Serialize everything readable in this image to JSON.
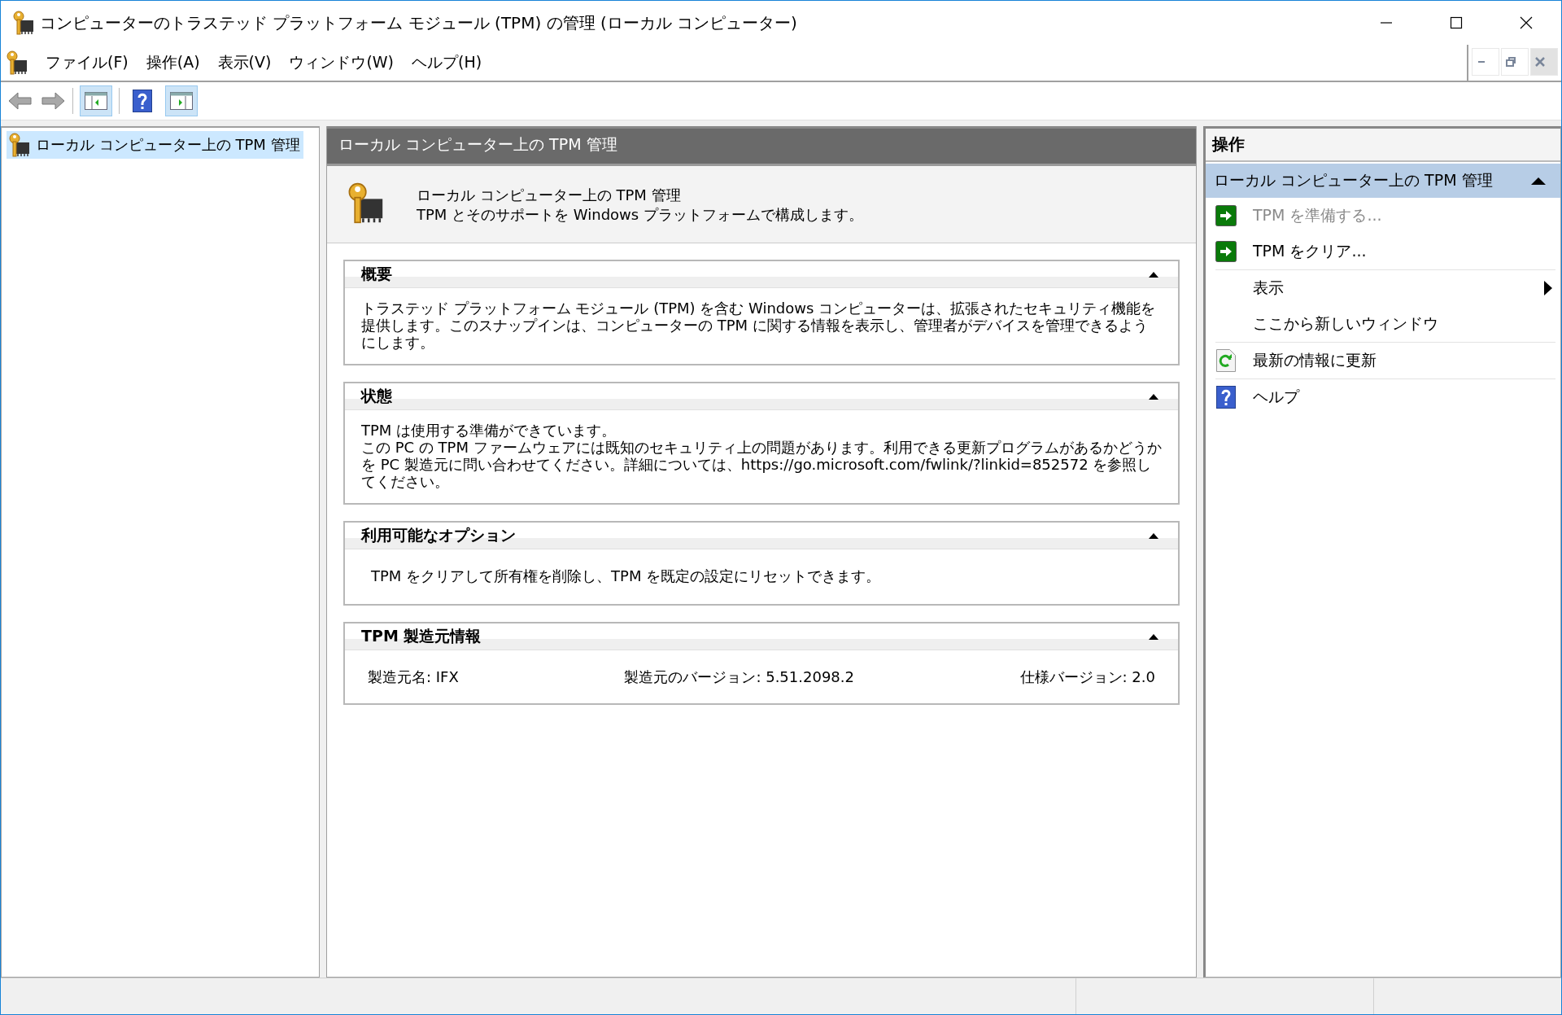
{
  "window": {
    "title": "コンピューターのトラステッド プラットフォーム モジュール (TPM) の管理 (ローカル コンピューター)"
  },
  "menu_bar": {
    "items": [
      "ファイル(F)",
      "操作(A)",
      "表示(V)",
      "ウィンドウ(W)",
      "ヘルプ(H)"
    ]
  },
  "tree": {
    "items": [
      {
        "label": "ローカル コンピューター上の TPM 管理",
        "selected": true
      }
    ]
  },
  "center": {
    "header": "ローカル コンピューター上の TPM 管理",
    "intro": {
      "title": "ローカル コンピューター上の TPM 管理",
      "description": "TPM とそのサポートを Windows プラットフォームで構成します。"
    },
    "sections": [
      {
        "title": "概要",
        "expanded": true,
        "kind": "text",
        "lines": [
          "トラステッド プラットフォーム モジュール (TPM) を含む Windows コンピューターは、拡張されたセキュリティ機能を提供します。このスナップインは、コンピューターの TPM に関する情報を表示し、管理者がデバイスを管理できるようにします。"
        ]
      },
      {
        "title": "状態",
        "expanded": true,
        "kind": "text",
        "lines": [
          "TPM は使用する準備ができています。",
          "この PC の TPM ファームウェアには既知のセキュリティ上の問題があります。利用できる更新プログラムがあるかどうかを PC 製造元に問い合わせてください。詳細については、https://go.microsoft.com/fwlink/?linkid=852572 を参照してください。"
        ]
      },
      {
        "title": "利用可能なオプション",
        "expanded": true,
        "kind": "option",
        "lines": [
          "TPM をクリアして所有権を削除し、TPM を既定の設定にリセットできます。"
        ]
      },
      {
        "title": "TPM 製造元情報",
        "expanded": true,
        "kind": "fields",
        "lines": [
          "製造元名: IFX",
          "製造元のバージョン: 5.51.2098.2",
          "仕様バージョン: 2.0"
        ]
      }
    ]
  },
  "actions": {
    "title": "操作",
    "group": {
      "label": "ローカル コンピューター上の TPM 管理",
      "expanded": true
    },
    "items": [
      {
        "label": "TPM を準備する...",
        "kind": "run",
        "disabled": true
      },
      {
        "label": "TPM をクリア...",
        "kind": "run",
        "disabled": false
      },
      {
        "label": "表示",
        "kind": "submenu",
        "disabled": false
      },
      {
        "label": "ここから新しいウィンドウ",
        "kind": "plain",
        "disabled": false
      },
      {
        "label": "最新の情報に更新",
        "kind": "refresh",
        "disabled": false
      },
      {
        "label": "ヘルプ",
        "kind": "help",
        "disabled": false
      }
    ]
  }
}
